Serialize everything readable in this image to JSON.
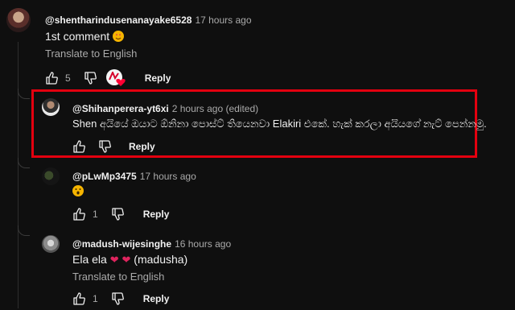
{
  "comments": [
    {
      "handle": "@shentharindusenanayake6528",
      "time": "17 hours ago",
      "text": "1st comment",
      "translate": "Translate to English",
      "likes": "5",
      "reply_label": "Reply"
    },
    {
      "handle": "@Shihanperera-yt6xi",
      "time": "2 hours ago (edited)",
      "text": "Shen අයියේ ඔයාට ඕනිනා පොස්ට් තියෙනවා Elakiri එකේ. හැක් කරලා අයියගේ නැට් පෙන්නමු.",
      "reply_label": "Reply"
    },
    {
      "handle": "@pLwMp3475",
      "time": "17 hours ago",
      "likes": "1",
      "reply_label": "Reply"
    },
    {
      "handle": "@madush-wijesinghe",
      "time": "16 hours ago",
      "text_before": "Ela ela",
      "text_after": "(madusha)",
      "translate": "Translate to English",
      "likes": "1",
      "reply_label": "Reply"
    }
  ],
  "colors": {
    "background": "#0f0f0f",
    "highlight": "#e3000f",
    "muted": "#aaaaaa"
  },
  "icons": [
    "like-icon",
    "dislike-icon",
    "creator-heart-icon",
    "heart-eyes-emoji",
    "surprised-emoji",
    "red-heart-emoji"
  ]
}
